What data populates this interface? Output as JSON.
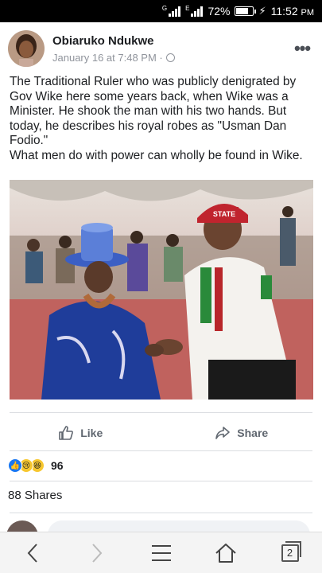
{
  "status_bar": {
    "battery": "72%",
    "time": "11:52",
    "ampm": "PM",
    "signal_label_1": "G",
    "signal_label_2": "E"
  },
  "post": {
    "author": "Obiaruko Ndukwe",
    "timestamp": "January 16 at 7:48 PM ·",
    "paragraph_1": "The Traditional Ruler who was publicly denigrated by Gov Wike here some years back, when Wike was a Minister. He shook the man with his two hands. But today, he describes his royal robes as \"Usman Dan Fodio.\"",
    "paragraph_2": "What men do with power can wholly be found in Wike.",
    "photo_cap_text": "STATE"
  },
  "actions": {
    "like_label": "Like",
    "share_label": "Share"
  },
  "reactions": {
    "count": "96"
  },
  "shares": {
    "label": "88 Shares"
  },
  "browser_nav": {
    "tab_count": "2"
  }
}
